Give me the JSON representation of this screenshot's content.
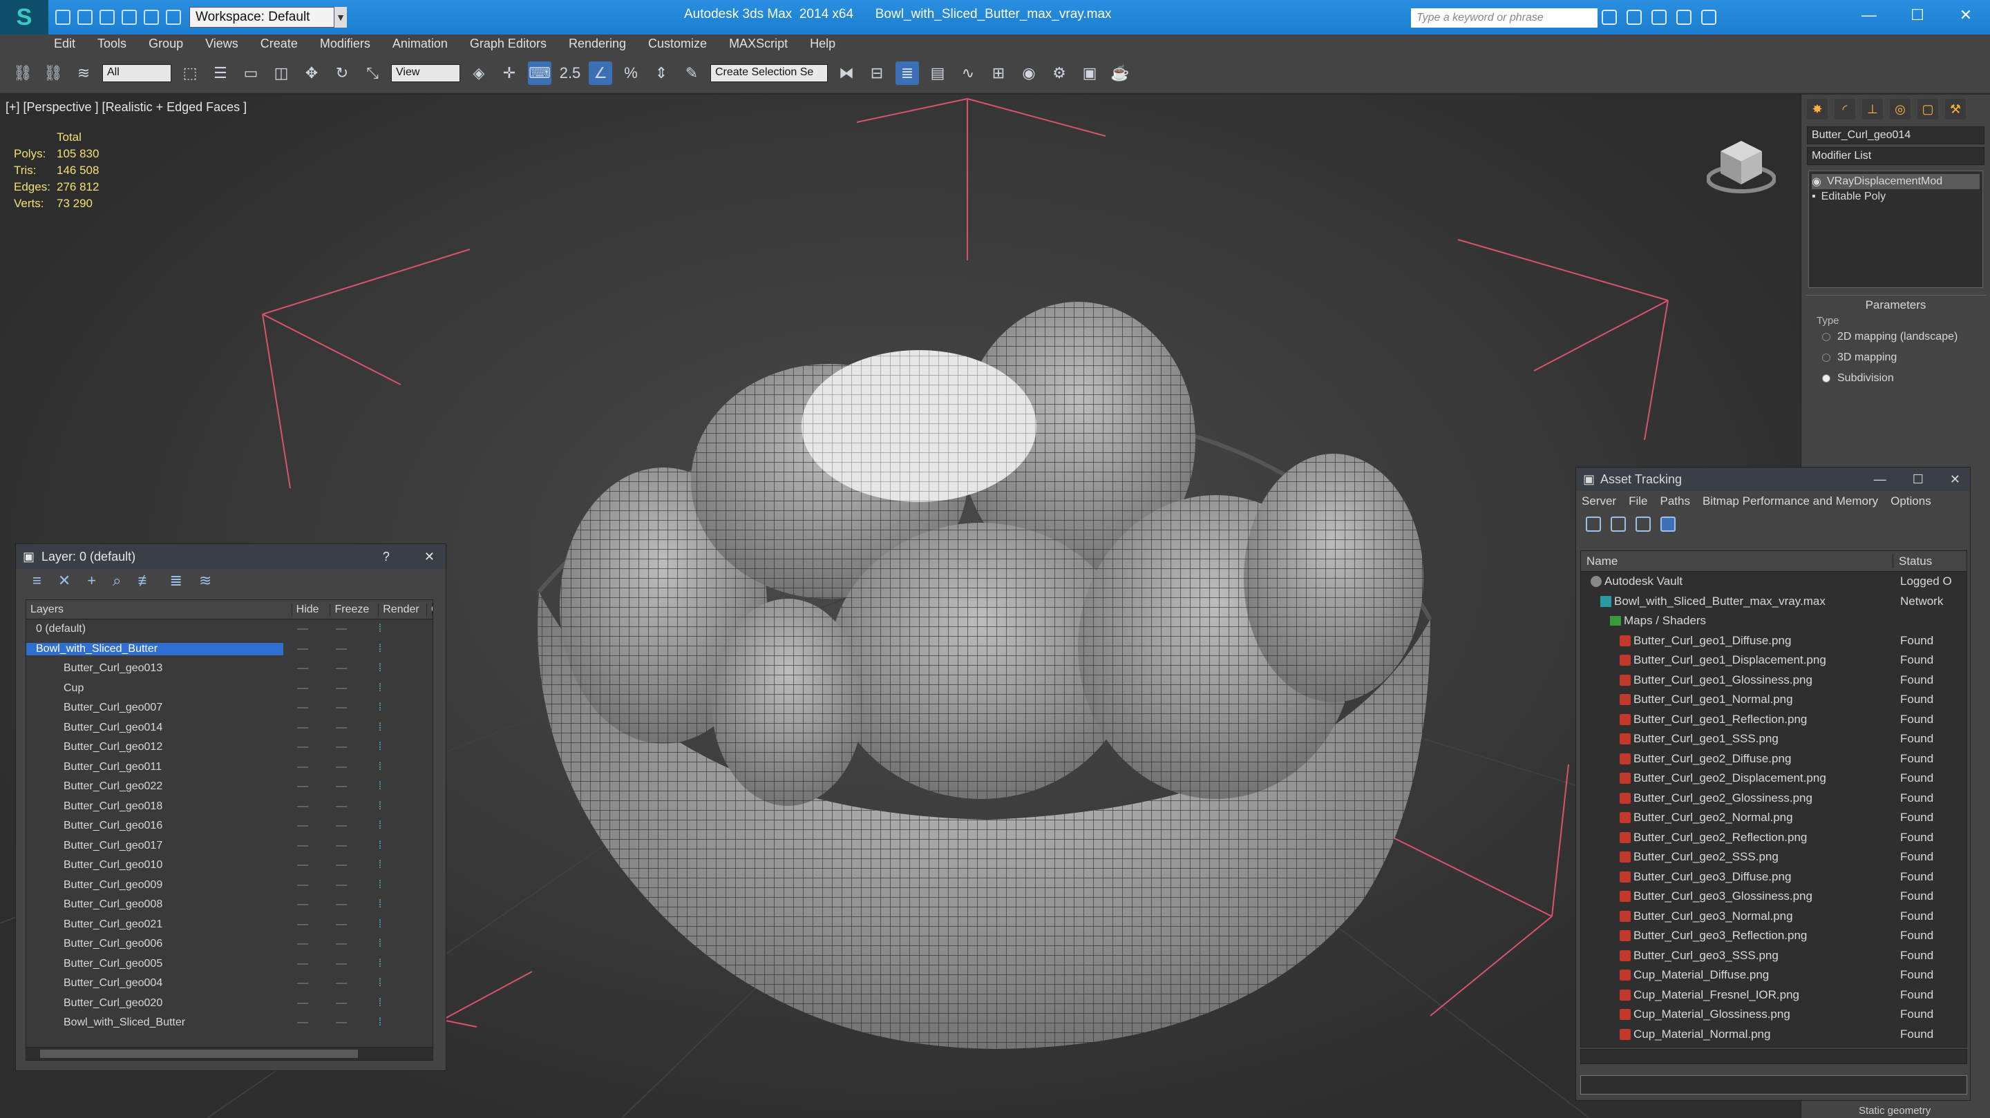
{
  "titlebar": {
    "workspace": "Workspace: Default",
    "app_title": "Autodesk 3ds Max  2014 x64",
    "file_title": "Bowl_with_Sliced_Butter_max_vray.max",
    "search_placeholder": "Type a keyword or phrase"
  },
  "menu": [
    "Edit",
    "Tools",
    "Group",
    "Views",
    "Create",
    "Modifiers",
    "Animation",
    "Graph Editors",
    "Rendering",
    "Customize",
    "MAXScript",
    "Help"
  ],
  "toolbar": {
    "filter": "All",
    "ref_coord": "View",
    "snap_label": "2.5",
    "selection_set": "Create Selection Se"
  },
  "viewport": {
    "label": "[+] [Perspective ] [Realistic + Edged Faces ]",
    "stats_header": "Total",
    "stats": [
      {
        "k": "Polys:",
        "v": "105 830"
      },
      {
        "k": "Tris:",
        "v": "146 508"
      },
      {
        "k": "Edges:",
        "v": "276 812"
      },
      {
        "k": "Verts:",
        "v": "73 290"
      }
    ]
  },
  "command_panel": {
    "object_name": "Butter_Curl_geo014",
    "modifier_list": "Modifier List",
    "stack": [
      "VRayDisplacementMod",
      "Editable Poly"
    ],
    "params_title": "Parameters",
    "type_label": "Type",
    "options": [
      "2D mapping (landscape)",
      "3D mapping",
      "Subdivision"
    ],
    "selected_option": "Subdivision",
    "static_geometry": "Static geometry"
  },
  "layer_dialog": {
    "title": "Layer: 0 (default)",
    "columns": [
      "Layers",
      "Hide",
      "Freeze",
      "Render",
      "C"
    ],
    "rows": [
      {
        "name": "0 (default)",
        "level": 0
      },
      {
        "name": "Bowl_with_Sliced_Butter",
        "level": 0,
        "selected": true
      },
      {
        "name": "Butter_Curl_geo013",
        "level": 1
      },
      {
        "name": "Cup",
        "level": 1
      },
      {
        "name": "Butter_Curl_geo007",
        "level": 1
      },
      {
        "name": "Butter_Curl_geo014",
        "level": 1
      },
      {
        "name": "Butter_Curl_geo012",
        "level": 1
      },
      {
        "name": "Butter_Curl_geo011",
        "level": 1
      },
      {
        "name": "Butter_Curl_geo022",
        "level": 1
      },
      {
        "name": "Butter_Curl_geo018",
        "level": 1
      },
      {
        "name": "Butter_Curl_geo016",
        "level": 1
      },
      {
        "name": "Butter_Curl_geo017",
        "level": 1
      },
      {
        "name": "Butter_Curl_geo010",
        "level": 1
      },
      {
        "name": "Butter_Curl_geo009",
        "level": 1
      },
      {
        "name": "Butter_Curl_geo008",
        "level": 1
      },
      {
        "name": "Butter_Curl_geo021",
        "level": 1
      },
      {
        "name": "Butter_Curl_geo006",
        "level": 1
      },
      {
        "name": "Butter_Curl_geo005",
        "level": 1
      },
      {
        "name": "Butter_Curl_geo004",
        "level": 1
      },
      {
        "name": "Butter_Curl_geo020",
        "level": 1
      },
      {
        "name": "Bowl_with_Sliced_Butter",
        "level": 1
      }
    ]
  },
  "asset_tracking": {
    "title": "Asset Tracking",
    "menu": [
      "Server",
      "File",
      "Paths",
      "Bitmap Performance and Memory",
      "Options"
    ],
    "columns": [
      "Name",
      "Status"
    ],
    "rows": [
      {
        "name": "Autodesk Vault",
        "status": "Logged O",
        "indent": 1,
        "kind": "vault"
      },
      {
        "name": "Bowl_with_Sliced_Butter_max_vray.max",
        "status": "Network",
        "indent": 2,
        "kind": "max"
      },
      {
        "name": "Maps / Shaders",
        "status": "",
        "indent": 3,
        "kind": "folder"
      },
      {
        "name": "Butter_Curl_geo1_Diffuse.png",
        "status": "Found",
        "indent": 4,
        "kind": "png"
      },
      {
        "name": "Butter_Curl_geo1_Displacement.png",
        "status": "Found",
        "indent": 4,
        "kind": "png"
      },
      {
        "name": "Butter_Curl_geo1_Glossiness.png",
        "status": "Found",
        "indent": 4,
        "kind": "png"
      },
      {
        "name": "Butter_Curl_geo1_Normal.png",
        "status": "Found",
        "indent": 4,
        "kind": "png"
      },
      {
        "name": "Butter_Curl_geo1_Reflection.png",
        "status": "Found",
        "indent": 4,
        "kind": "png"
      },
      {
        "name": "Butter_Curl_geo1_SSS.png",
        "status": "Found",
        "indent": 4,
        "kind": "png"
      },
      {
        "name": "Butter_Curl_geo2_Diffuse.png",
        "status": "Found",
        "indent": 4,
        "kind": "png"
      },
      {
        "name": "Butter_Curl_geo2_Displacement.png",
        "status": "Found",
        "indent": 4,
        "kind": "png"
      },
      {
        "name": "Butter_Curl_geo2_Glossiness.png",
        "status": "Found",
        "indent": 4,
        "kind": "png"
      },
      {
        "name": "Butter_Curl_geo2_Normal.png",
        "status": "Found",
        "indent": 4,
        "kind": "png"
      },
      {
        "name": "Butter_Curl_geo2_Reflection.png",
        "status": "Found",
        "indent": 4,
        "kind": "png"
      },
      {
        "name": "Butter_Curl_geo2_SSS.png",
        "status": "Found",
        "indent": 4,
        "kind": "png"
      },
      {
        "name": "Butter_Curl_geo3_Diffuse.png",
        "status": "Found",
        "indent": 4,
        "kind": "png"
      },
      {
        "name": "Butter_Curl_geo3_Glossiness.png",
        "status": "Found",
        "indent": 4,
        "kind": "png"
      },
      {
        "name": "Butter_Curl_geo3_Normal.png",
        "status": "Found",
        "indent": 4,
        "kind": "png"
      },
      {
        "name": "Butter_Curl_geo3_Reflection.png",
        "status": "Found",
        "indent": 4,
        "kind": "png"
      },
      {
        "name": "Butter_Curl_geo3_SSS.png",
        "status": "Found",
        "indent": 4,
        "kind": "png"
      },
      {
        "name": "Cup_Material_Diffuse.png",
        "status": "Found",
        "indent": 4,
        "kind": "png"
      },
      {
        "name": "Cup_Material_Fresnel_IOR.png",
        "status": "Found",
        "indent": 4,
        "kind": "png"
      },
      {
        "name": "Cup_Material_Glossiness.png",
        "status": "Found",
        "indent": 4,
        "kind": "png"
      },
      {
        "name": "Cup_Material_Normal.png",
        "status": "Found",
        "indent": 4,
        "kind": "png"
      }
    ]
  },
  "colors": {
    "accent": "#2f6fd1",
    "titlebar": "#2a8fe0",
    "stats_text": "#f4e070",
    "gizmo": "#d9536d"
  }
}
